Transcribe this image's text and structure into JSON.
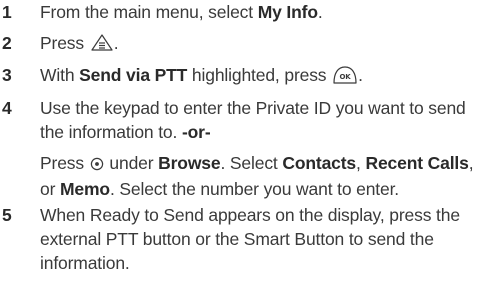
{
  "steps": [
    {
      "number": "1",
      "text_a": "From the main menu, select ",
      "bold_a": "My Info",
      "text_b": "."
    },
    {
      "number": "2",
      "text_a": "Press ",
      "icon": "menu-key-icon",
      "text_b": "."
    },
    {
      "number": "3",
      "text_a": "With ",
      "bold_a": "Send via PTT",
      "text_b": " highlighted, press ",
      "icon": "ok-key-icon",
      "text_c": "."
    },
    {
      "number": "4",
      "text_a": "Use the keypad to enter the Private ID you want to send the information to. ",
      "bold_a": "-or-",
      "p2_text_a": "Press ",
      "p2_icon": "nav-key-icon",
      "p2_text_b": " under ",
      "p2_bold_a": "Browse",
      "p2_text_c": ". Select ",
      "p2_bold_b": "Contacts",
      "p2_text_d": ", ",
      "p2_bold_c": "Recent Calls",
      "p2_text_e": ", or ",
      "p2_bold_d": "Memo",
      "p2_text_f": ". Select the number you want to enter."
    },
    {
      "number": "5",
      "text_a": "When Ready to Send appears on the display, press the external PTT button or the Smart Button to send the information."
    }
  ],
  "key_glyphs": {
    "ok": "OK"
  }
}
